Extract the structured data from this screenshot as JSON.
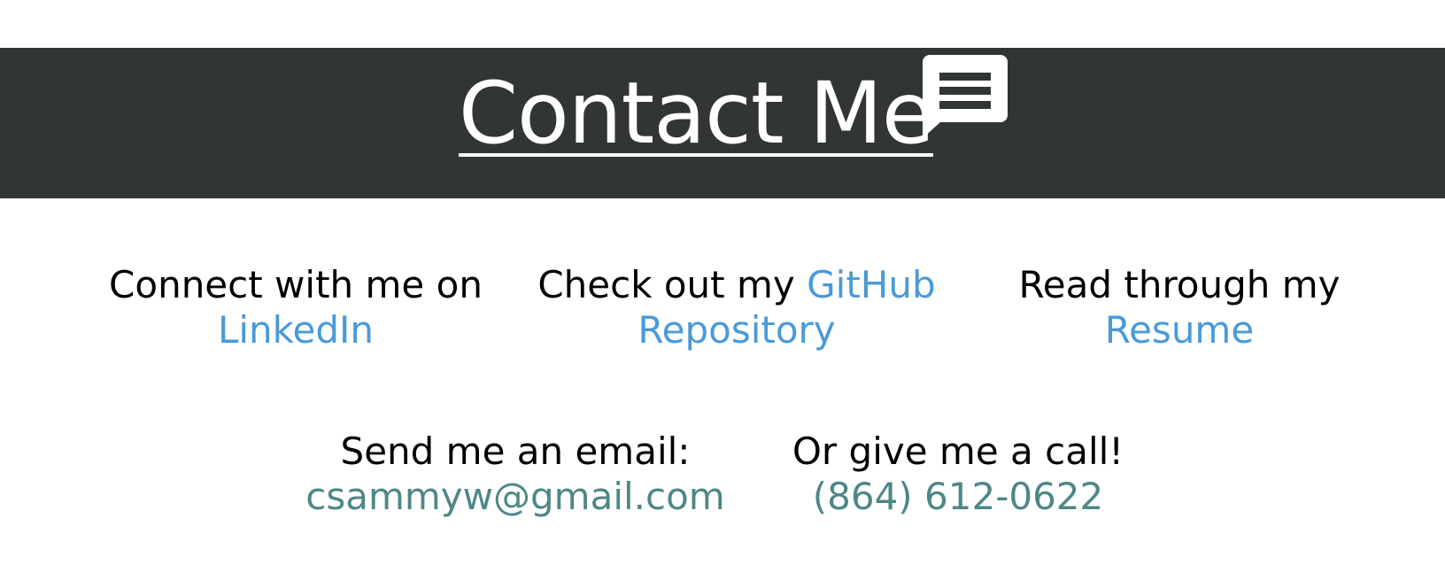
{
  "header": {
    "title": "Contact Me",
    "icon": "chat-bubble-icon",
    "background_color": "#313634",
    "text_color": "#ffffff"
  },
  "links": {
    "linkedin": {
      "prefix": "Connect with me on",
      "label": "LinkedIn"
    },
    "github": {
      "prefix": "Check out my",
      "label_part1": "GitHub",
      "label_part2": "Repository"
    },
    "resume": {
      "prefix": "Read through my",
      "label": "Resume"
    }
  },
  "contact": {
    "email": {
      "label": "Send me an email:",
      "value": "csammyw@gmail.com"
    },
    "phone": {
      "label": "Or give me a call!",
      "value": "(864) 612-0622"
    }
  },
  "colors": {
    "link": "#4a9ad8",
    "contact_value": "#4e8786"
  }
}
